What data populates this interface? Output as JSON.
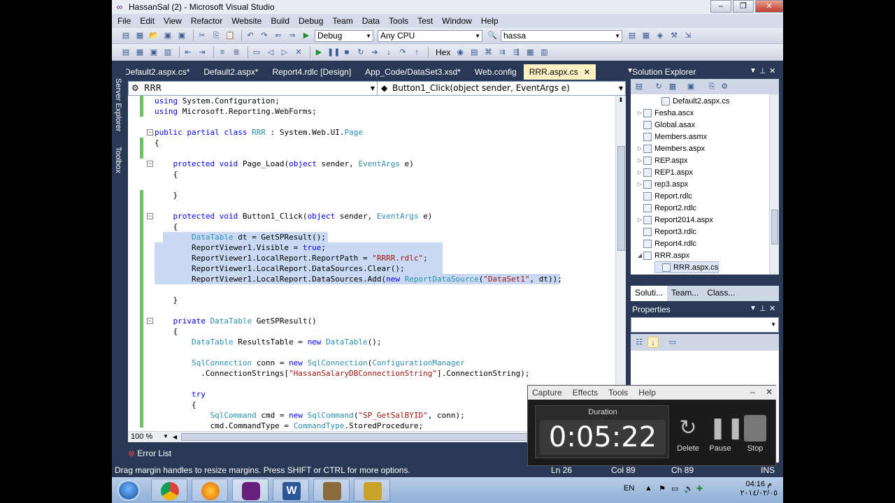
{
  "window": {
    "title": "HassanSal (2) - Microsoft Visual Studio",
    "min": "–",
    "max": "❐",
    "close": "✕"
  },
  "menu": [
    "File",
    "Edit",
    "View",
    "Refactor",
    "Website",
    "Build",
    "Debug",
    "Team",
    "Data",
    "Tools",
    "Test",
    "Window",
    "Help"
  ],
  "toolbar": {
    "config": "Debug",
    "platform": "Any CPU",
    "find": "hassa",
    "hex": "Hex"
  },
  "tabs": [
    "Default2.aspx.cs*",
    "Default2.aspx*",
    "Report4.rdlc [Design]",
    "App_Code/DataSet3.xsd*",
    "Web.config",
    "RRR.aspx.cs"
  ],
  "tab_close": "✕",
  "side": {
    "server_explorer": "Server Explorer",
    "toolbox": "Toolbox"
  },
  "nav": {
    "class": "RRR",
    "member": "Button1_Click(object sender, EventArgs e)"
  },
  "code": [
    "using System.Configuration;",
    "using Microsoft.Reporting.WebForms;",
    "",
    "public partial class RRR : System.Web.UI.Page",
    "{",
    "",
    "    protected void Page_Load(object sender, EventArgs e)",
    "    {",
    "",
    "    }",
    "",
    "    protected void Button1_Click(object sender, EventArgs e)",
    "    {",
    "        DataTable dt = GetSPResult();",
    "        ReportViewer1.Visible = true;",
    "        ReportViewer1.LocalReport.ReportPath = \"RRRR.rdlc\";",
    "        ReportViewer1.LocalReport.DataSources.Clear();",
    "        ReportViewer1.LocalReport.DataSources.Add(new ReportDataSource(\"DataSet1\", dt));",
    "",
    "    }",
    "",
    "    private DataTable GetSPResult()",
    "    {",
    "        DataTable ResultsTable = new DataTable();",
    "",
    "        SqlConnection conn = new SqlConnection(ConfigurationManager",
    "          .ConnectionStrings[\"HassanSalaryDBConnectionString\"].ConnectionString);",
    "",
    "        try",
    "        {",
    "            SqlCommand cmd = new SqlCommand(\"SP_GetSalBYID\", conn);",
    "            cmd.CommandType = CommandType.StoredProcedure;"
  ],
  "zoom": "100 %",
  "error_list": "Error List",
  "status": {
    "message": "Drag margin handles to resize margins. Press SHIFT or CTRL for more options.",
    "ln": "Ln 26",
    "col": "Col 89",
    "ch": "Ch 89",
    "ins": "INS"
  },
  "solution_explorer": {
    "title": "Solution Explorer",
    "items": [
      {
        "label": "Default2.aspx.cs",
        "indent": 2,
        "expander": ""
      },
      {
        "label": "Fesha.ascx",
        "indent": 1,
        "expander": "▷"
      },
      {
        "label": "Global.asax",
        "indent": 1,
        "expander": ""
      },
      {
        "label": "Members.asmx",
        "indent": 1,
        "expander": ""
      },
      {
        "label": "Members.aspx",
        "indent": 1,
        "expander": "▷"
      },
      {
        "label": "REP.aspx",
        "indent": 1,
        "expander": "▷"
      },
      {
        "label": "REP1.aspx",
        "indent": 1,
        "expander": "▷"
      },
      {
        "label": "rep3.aspx",
        "indent": 1,
        "expander": "▷"
      },
      {
        "label": "Report.rdlc",
        "indent": 1,
        "expander": ""
      },
      {
        "label": "Report2.rdlc",
        "indent": 1,
        "expander": ""
      },
      {
        "label": "Report2014.aspx",
        "indent": 1,
        "expander": "▷"
      },
      {
        "label": "Report3.rdlc",
        "indent": 1,
        "expander": ""
      },
      {
        "label": "Report4.rdlc",
        "indent": 1,
        "expander": ""
      },
      {
        "label": "RRR.aspx",
        "indent": 1,
        "expander": "◢"
      },
      {
        "label": "RRR.aspx.cs",
        "indent": 2,
        "expander": ""
      }
    ],
    "tabs": [
      "Soluti...",
      "Team...",
      "Class..."
    ]
  },
  "properties": {
    "title": "Properties"
  },
  "capture": {
    "menu": [
      "Capture",
      "Effects",
      "Tools",
      "Help"
    ],
    "duration_label": "Duration",
    "duration": "0:05:22",
    "delete": "Delete",
    "pause": "Pause",
    "stop": "Stop",
    "min": "–",
    "close": "✕"
  },
  "clock": {
    "time": "04:16 م",
    "date": "٢٠١٤/٠٢/٠٥",
    "lang": "EN"
  },
  "colors": {
    "vs_chrome": "#293955",
    "selection": "#c9d9f4",
    "keyword": "#0000ff",
    "type": "#2b91af",
    "string": "#a31515",
    "change_bar": "#6cc261"
  }
}
